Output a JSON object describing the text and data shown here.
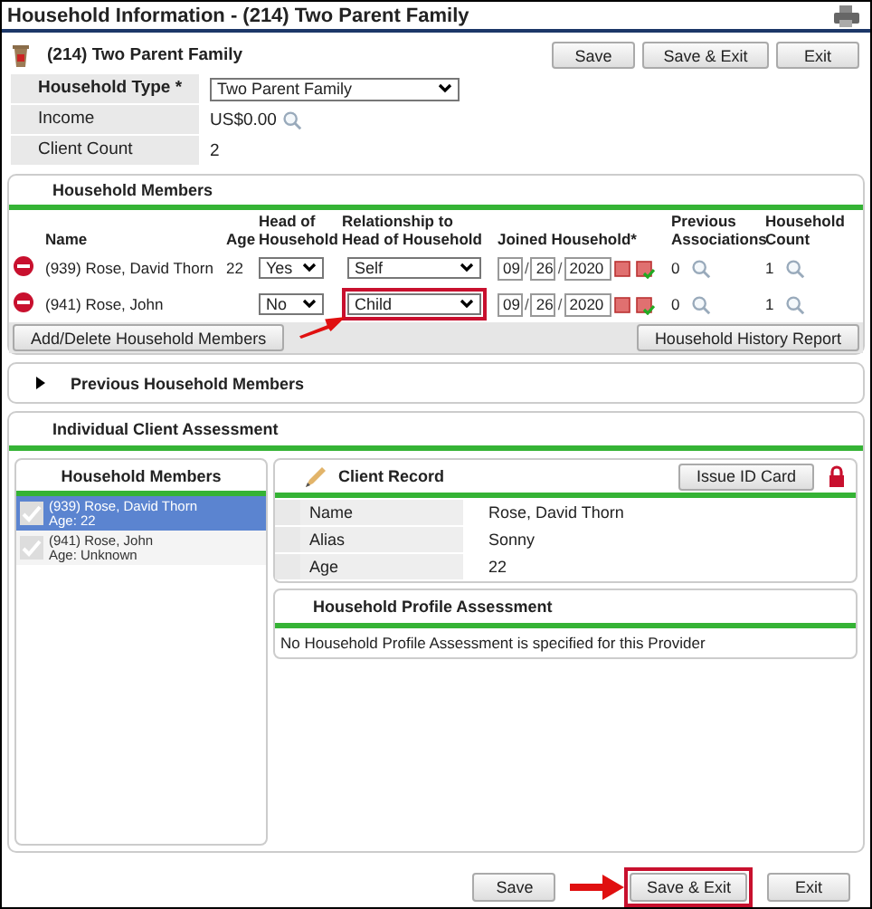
{
  "window": {
    "title": "Household Information - (214) Two Parent Family"
  },
  "header": {
    "title": "(214) Two Parent Family",
    "buttons": [
      "Save",
      "Save & Exit",
      "Exit"
    ]
  },
  "household_fields": [
    {
      "label": "Household Type *",
      "required": true,
      "kind": "select",
      "value": "Two Parent Family"
    },
    {
      "label": "Income",
      "required": false,
      "kind": "lookup",
      "value": "US$0.00"
    },
    {
      "label": "Client Count",
      "required": false,
      "kind": "text",
      "value": "2"
    }
  ],
  "members": {
    "title": "Household Members",
    "columns": [
      "Name",
      "Age",
      "Head of Household",
      "Relationship to Head of Household",
      "Joined Household*",
      "Previous Associations",
      "Household Count"
    ],
    "date_separator": "/",
    "rows": [
      {
        "name": "(939) Rose, David Thorn",
        "age": "22",
        "head": "Yes",
        "relationship": "Self",
        "highlighted": false,
        "joined": [
          "09",
          "26",
          "2020"
        ],
        "previous": "0",
        "count": "1"
      },
      {
        "name": "(941) Rose, John",
        "head": "No",
        "relationship": "Child",
        "highlighted": true,
        "joined": [
          "09",
          "26",
          "2020"
        ],
        "previous": "0",
        "count": "1"
      }
    ],
    "buttons": [
      "Add/Delete Household Members",
      "Household History Report"
    ]
  },
  "previous_members": {
    "title": "Previous Household Members",
    "expanded": false
  },
  "assessment": {
    "title": "Individual Client Assessment",
    "members_panel": {
      "title": "Household Members",
      "items": [
        {
          "name": "(939) Rose, David Thorn",
          "age": "Age: 22",
          "selected": true
        },
        {
          "name": "(941) Rose, John",
          "age": "Age: Unknown",
          "selected": false
        }
      ]
    },
    "client_record": {
      "title": "Client Record",
      "button": "Issue ID Card",
      "fields": [
        {
          "label": "Name",
          "value": "Rose, David Thorn"
        },
        {
          "label": "Alias",
          "value": "Sonny"
        },
        {
          "label": "Age",
          "value": "22"
        }
      ]
    },
    "profile": {
      "title": "Household Profile Assessment",
      "message": "No Household Profile Assessment is specified for this Provider"
    }
  },
  "footer": {
    "buttons": [
      {
        "label": "Save",
        "highlighted": false
      },
      {
        "label": "Save & Exit",
        "highlighted": true
      },
      {
        "label": "Exit",
        "highlighted": false
      }
    ]
  }
}
